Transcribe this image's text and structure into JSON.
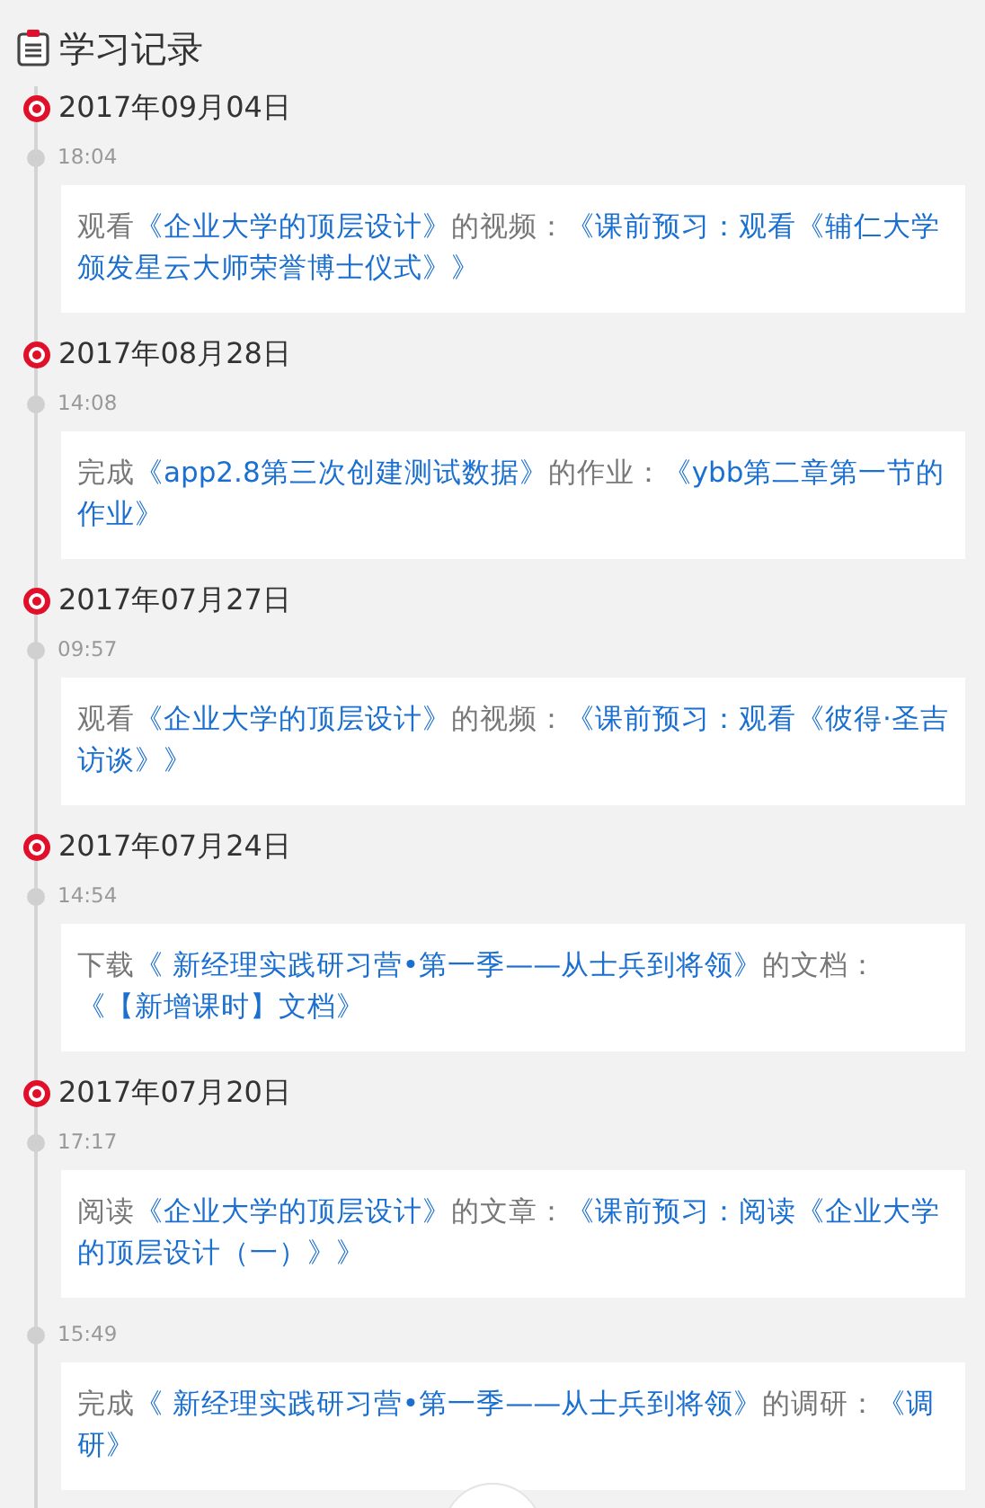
{
  "title": "学习记录",
  "days": [
    {
      "date": "2017年09月04日",
      "entries": [
        {
          "time": "18:04",
          "parts": [
            {
              "text": "观看",
              "link": false
            },
            {
              "text": "《企业大学的顶层设计》",
              "link": true
            },
            {
              "text": "的视频：",
              "link": false
            },
            {
              "text": "《课前预习：观看《辅仁大学颁发星云大师荣誉博士仪式》》",
              "link": true
            }
          ]
        }
      ]
    },
    {
      "date": "2017年08月28日",
      "entries": [
        {
          "time": "14:08",
          "parts": [
            {
              "text": "完成",
              "link": false
            },
            {
              "text": "《app2.8第三次创建测试数据》",
              "link": true
            },
            {
              "text": "的作业：",
              "link": false
            },
            {
              "text": "《ybb第二章第一节的作业》",
              "link": true
            }
          ]
        }
      ]
    },
    {
      "date": "2017年07月27日",
      "entries": [
        {
          "time": "09:57",
          "parts": [
            {
              "text": "观看",
              "link": false
            },
            {
              "text": "《企业大学的顶层设计》",
              "link": true
            },
            {
              "text": "的视频：",
              "link": false
            },
            {
              "text": "《课前预习：观看《彼得·圣吉访谈》》",
              "link": true
            }
          ]
        }
      ]
    },
    {
      "date": "2017年07月24日",
      "entries": [
        {
          "time": "14:54",
          "parts": [
            {
              "text": "下载",
              "link": false
            },
            {
              "text": "《 新经理实践研习营•第一季——从士兵到将领》",
              "link": true
            },
            {
              "text": "的文档：",
              "link": false
            },
            {
              "text": "《【新增课时】文档》",
              "link": true
            }
          ]
        }
      ]
    },
    {
      "date": "2017年07月20日",
      "entries": [
        {
          "time": "17:17",
          "parts": [
            {
              "text": "阅读",
              "link": false
            },
            {
              "text": "《企业大学的顶层设计》",
              "link": true
            },
            {
              "text": "的文章：",
              "link": false
            },
            {
              "text": "《课前预习：阅读《企业大学的顶层设计（一）》》",
              "link": true
            }
          ]
        },
        {
          "time": "15:49",
          "parts": [
            {
              "text": "完成",
              "link": false
            },
            {
              "text": "《 新经理实践研习营•第一季——从士兵到将领》",
              "link": true
            },
            {
              "text": "的调研：",
              "link": false
            },
            {
              "text": "《调研》",
              "link": true
            }
          ]
        }
      ]
    }
  ]
}
